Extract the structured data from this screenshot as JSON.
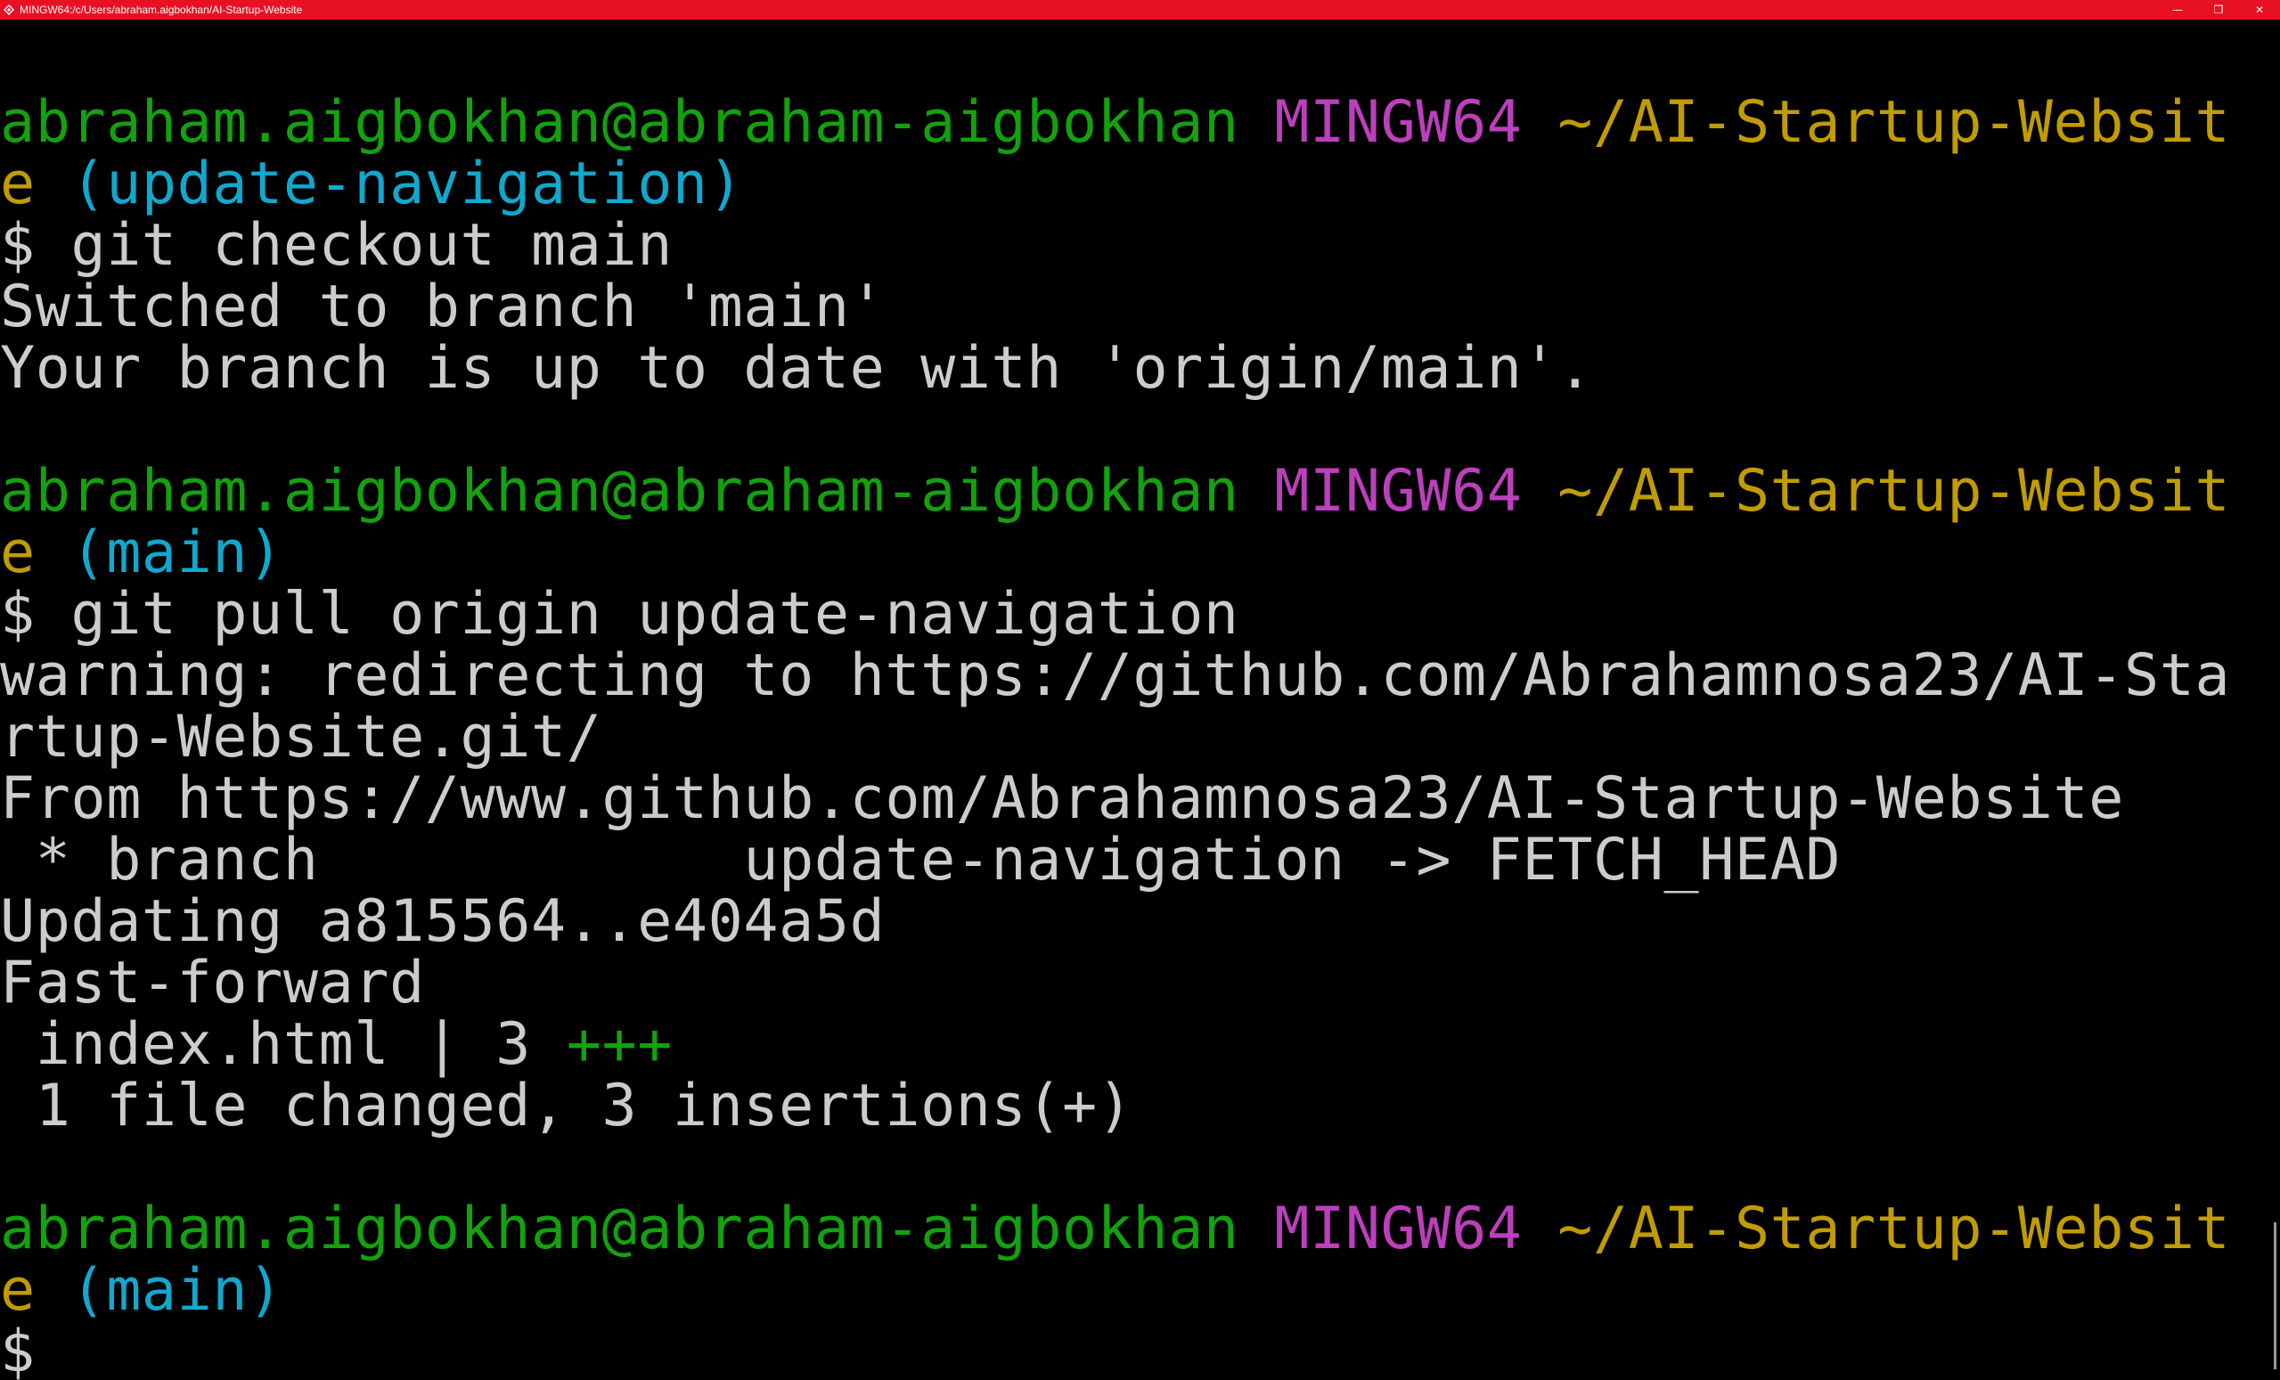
{
  "window": {
    "title": "MINGW64:/c/Users/abraham.aigbokhan/AI-Startup-Website",
    "minimize_glyph": "—",
    "restore_glyph": "❐",
    "close_glyph": "✕"
  },
  "colors": {
    "titlebar": "#e81123",
    "user_host": "#13a10e",
    "mingw": "#bc3fbc",
    "path": "#c19c00",
    "branch": "#11a8cd",
    "text": "#cccccc"
  },
  "terminal": {
    "p1": {
      "user": "abraham.aigbokhan@abraham-aigbokhan",
      "env": "MINGW64",
      "path_a": "~/AI-Startup-Websit",
      "path_b": "e",
      "branch": "(update-navigation)"
    },
    "cmd1": "$ git checkout main",
    "out1": "Switched to branch 'main'",
    "out2": "Your branch is up to date with 'origin/main'.",
    "p2": {
      "user": "abraham.aigbokhan@abraham-aigbokhan",
      "env": "MINGW64",
      "path_a": "~/AI-Startup-Websit",
      "path_b": "e",
      "branch": "(main)"
    },
    "cmd2": "$ git pull origin update-navigation",
    "out3": "warning: redirecting to https://github.com/Abrahamnosa23/AI-Sta",
    "out4": "rtup-Website.git/",
    "out5": "From https://www.github.com/Abrahamnosa23/AI-Startup-Website",
    "out6": " * branch            update-navigation -> FETCH_HEAD",
    "out7": "Updating a815564..e404a5d",
    "out8": "Fast-forward",
    "out9_file": " index.html | 3 ",
    "out9_plus": "+++",
    "out10": " 1 file changed, 3 insertions(+)",
    "p3": {
      "user": "abraham.aigbokhan@abraham-aigbokhan",
      "env": "MINGW64",
      "path_a": "~/AI-Startup-Websit",
      "path_b": "e",
      "branch": "(main)"
    },
    "cursor_prompt": "$"
  }
}
